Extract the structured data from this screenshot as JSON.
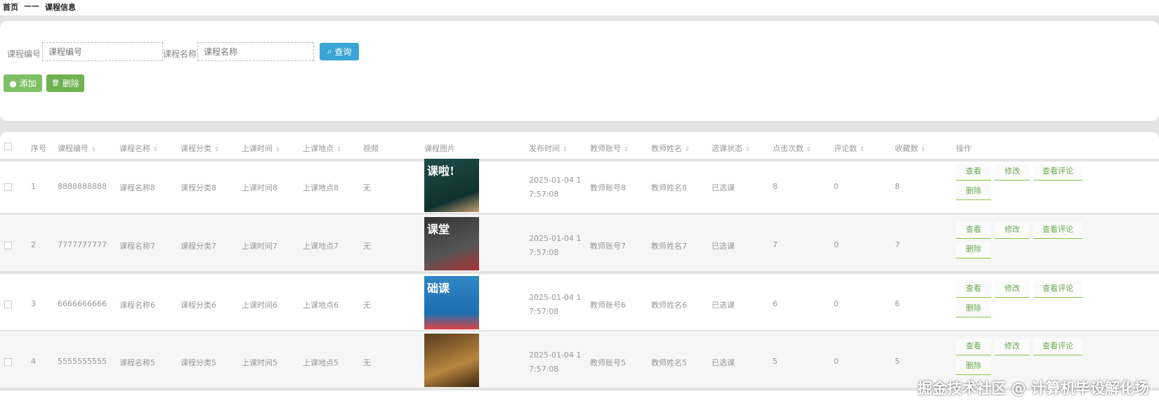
{
  "breadcrumb": {
    "home": "首页",
    "sep": "——",
    "current": "课程信息"
  },
  "search": {
    "code_label": "课程编号",
    "code_placeholder": "课程编号",
    "name_label": "课程名称",
    "name_placeholder": "课程名称",
    "search_button": "查询"
  },
  "actions": {
    "add": "添加",
    "delete": "删除"
  },
  "columns": [
    "序号",
    "课程编号",
    "课程名称",
    "课程分类",
    "上课时间",
    "上课地点",
    "视频",
    "课程图片",
    "发布时间",
    "教师账号",
    "教师姓名",
    "选课状态",
    "点击次数",
    "评论数",
    "收藏数",
    "操作"
  ],
  "ops": {
    "view": "查看",
    "edit": "修改",
    "view_comments": "查看评论",
    "delete": "删除"
  },
  "rows": [
    {
      "idx": "1",
      "code": "8888888888",
      "name": "课程名称8",
      "cat": "课程分类8",
      "time": "上课时间8",
      "place": "上课地点8",
      "video": "无",
      "img_text": "课啦!",
      "date1": "2025-01-04 1",
      "date2": "7:57:08",
      "tacc": "教师账号8",
      "tname": "教师姓名8",
      "status": "已选课",
      "clicks": "8",
      "comments": "0",
      "favs": "8"
    },
    {
      "idx": "2",
      "code": "7777777777",
      "name": "课程名称7",
      "cat": "课程分类7",
      "time": "上课时间7",
      "place": "上课地点7",
      "video": "无",
      "img_text": "课堂",
      "date1": "2025-01-04 1",
      "date2": "7:57:08",
      "tacc": "教师账号7",
      "tname": "教师姓名7",
      "status": "已选课",
      "clicks": "7",
      "comments": "0",
      "favs": "7"
    },
    {
      "idx": "3",
      "code": "6666666666",
      "name": "课程名称6",
      "cat": "课程分类6",
      "time": "上课时间6",
      "place": "上课地点6",
      "video": "无",
      "img_text": "础课",
      "date1": "2025-01-04 1",
      "date2": "7:57:08",
      "tacc": "教师账号6",
      "tname": "教师姓名6",
      "status": "已选课",
      "clicks": "6",
      "comments": "0",
      "favs": "6"
    },
    {
      "idx": "4",
      "code": "5555555555",
      "name": "课程名称5",
      "cat": "课程分类5",
      "time": "上课时间5",
      "place": "上课地点5",
      "video": "无",
      "img_text": "",
      "date1": "2025-01-04 1",
      "date2": "7:57:08",
      "tacc": "教师账号5",
      "tname": "教师姓名5",
      "status": "已选课",
      "clicks": "5",
      "comments": "0",
      "favs": "5"
    }
  ],
  "watermark": "掘金技术社区 @ 计算机毕设解化场"
}
